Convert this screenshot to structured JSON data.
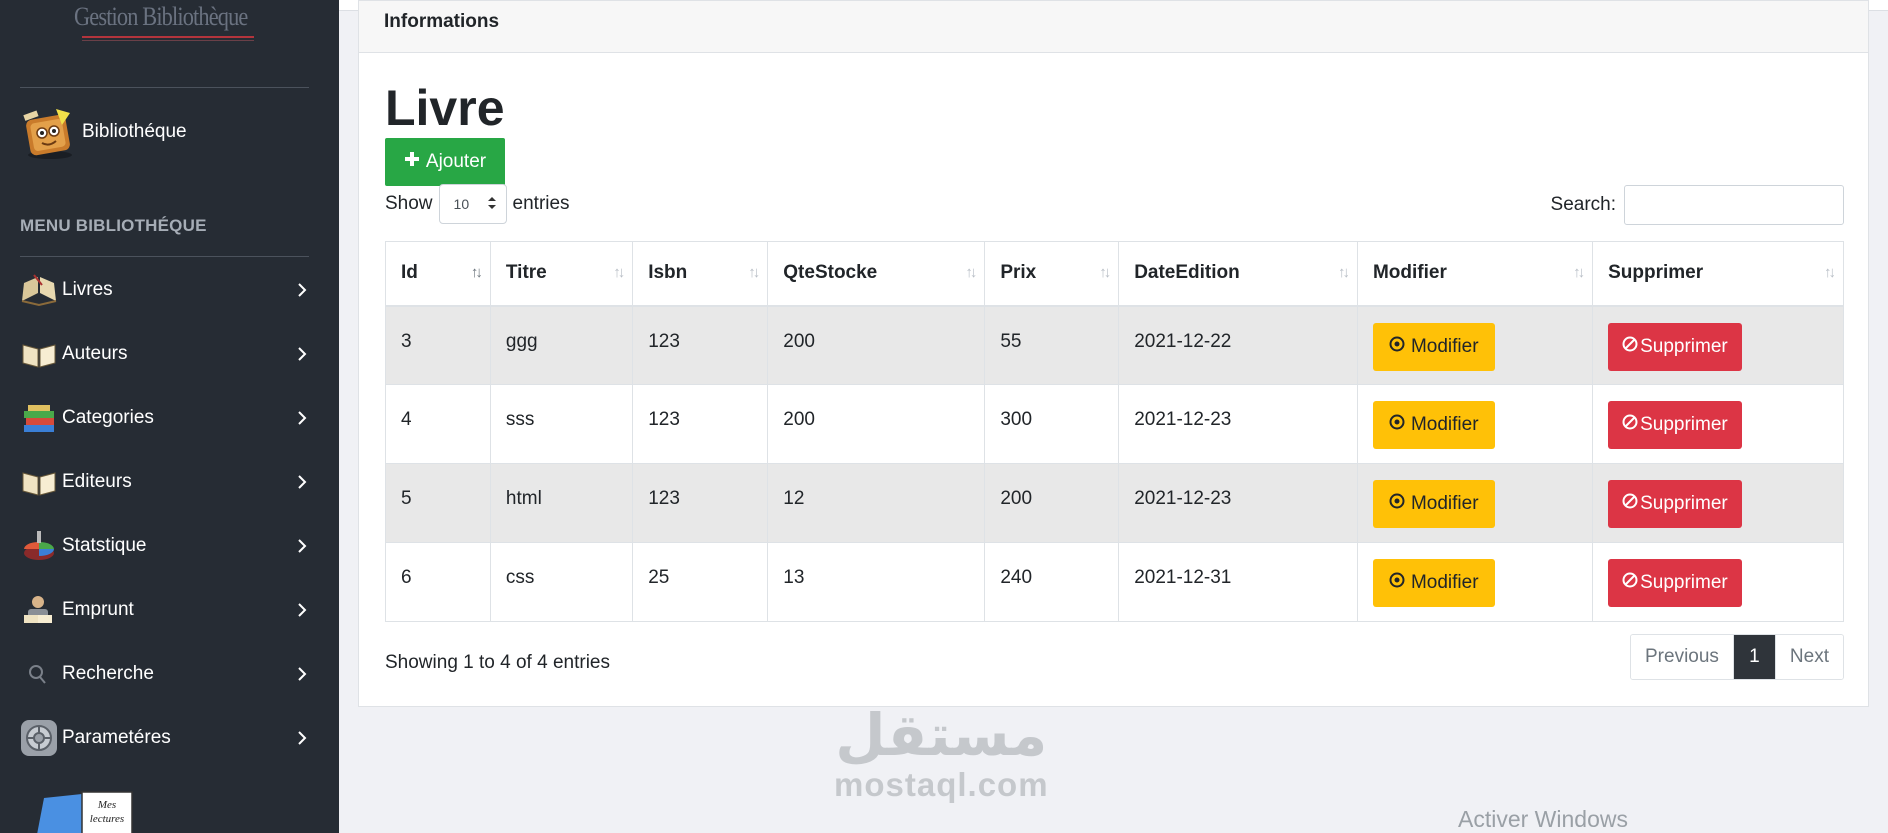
{
  "sidebar": {
    "brand": "Gestion Bibliothèque",
    "user_label": "Bibliothéque",
    "menu_title": "MENU BIBLIOTHÉQUE",
    "items": [
      {
        "label": "Livres",
        "icon": "open-book-icon"
      },
      {
        "label": "Auteurs",
        "icon": "book-icon"
      },
      {
        "label": "Categories",
        "icon": "books-stack-icon"
      },
      {
        "label": "Editeurs",
        "icon": "book-icon"
      },
      {
        "label": "Statstique",
        "icon": "pie-chart-icon"
      },
      {
        "label": "Emprunt",
        "icon": "reader-icon"
      },
      {
        "label": "Recherche",
        "icon": "search-icon"
      },
      {
        "label": "Parametéres",
        "icon": "settings-icon"
      }
    ],
    "bottom_image_text": "Mes lectures"
  },
  "card": {
    "header": "Informations",
    "title": "Livre",
    "add_label": "Ajouter"
  },
  "table_controls": {
    "show_label": "Show",
    "entries_label": "entries",
    "length_value": "10",
    "search_label": "Search:",
    "search_value": ""
  },
  "table": {
    "columns": [
      "Id",
      "Titre",
      "Isbn",
      "QteStocke",
      "Prix",
      "DateEdition",
      "Modifier",
      "Supprimer"
    ],
    "rows": [
      {
        "id": "3",
        "titre": "ggg",
        "isbn": "123",
        "qte": "200",
        "prix": "55",
        "date": "2021-12-22"
      },
      {
        "id": "4",
        "titre": "sss",
        "isbn": "123",
        "qte": "200",
        "prix": "300",
        "date": "2021-12-23"
      },
      {
        "id": "5",
        "titre": "html",
        "isbn": "123",
        "qte": "12",
        "prix": "200",
        "date": "2021-12-23"
      },
      {
        "id": "6",
        "titre": "css",
        "isbn": "25",
        "qte": "13",
        "prix": "240",
        "date": "2021-12-31"
      }
    ],
    "modify_label": "Modifier",
    "delete_label": "Supprimer"
  },
  "footer": {
    "info": "Showing 1 to 4 of 4 entries",
    "previous": "Previous",
    "page": "1",
    "next": "Next"
  },
  "watermark": {
    "arabic": "مستقل",
    "latin": "mostaql.com"
  },
  "activate_windows": "Activer Windows",
  "colors": {
    "sidebar": "#262c34",
    "success": "#28a745",
    "warning": "#ffc107",
    "danger": "#dc3545"
  }
}
